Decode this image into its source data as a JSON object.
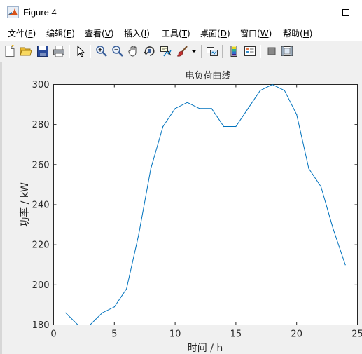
{
  "window": {
    "title": "Figure 4",
    "icons": [
      "matlab-logo-icon",
      "minimize-icon",
      "maximize-icon"
    ]
  },
  "menu": {
    "items": [
      {
        "name": "menu-file",
        "label": "文件(",
        "key": "F",
        "end": ")"
      },
      {
        "name": "menu-edit",
        "label": "编辑(",
        "key": "E",
        "end": ")"
      },
      {
        "name": "menu-view",
        "label": "查看(",
        "key": "V",
        "end": ")"
      },
      {
        "name": "menu-insert",
        "label": "插入(",
        "key": "I",
        "end": ")"
      },
      {
        "name": "menu-tools",
        "label": "工具(",
        "key": "T",
        "end": ")"
      },
      {
        "name": "menu-desktop",
        "label": "桌面(",
        "key": "D",
        "end": ")"
      },
      {
        "name": "menu-window",
        "label": "窗口(",
        "key": "W",
        "end": ")"
      },
      {
        "name": "menu-help",
        "label": "帮助(",
        "key": "H",
        "end": ")"
      }
    ]
  },
  "toolbar": {
    "icons": [
      "new-figure-icon",
      "open-file-icon",
      "save-icon",
      "print-icon",
      "edit-plot-icon",
      "zoom-in-icon",
      "zoom-out-icon",
      "pan-icon",
      "rotate-3d-icon",
      "data-cursor-icon",
      "brush-icon",
      "brush-dropdown-icon",
      "link-plot-icon",
      "insert-colorbar-icon",
      "insert-legend-icon",
      "hide-plot-tools-icon",
      "show-plot-tools-icon"
    ]
  },
  "colors": {
    "line": "#0072bd",
    "figure_bg": "#f0f0f0",
    "axes_bg": "#ffffff"
  },
  "chart_data": {
    "type": "line",
    "title": "电负荷曲线",
    "xlabel": "时间 / h",
    "ylabel": "功率 / kW",
    "xlim": [
      0,
      25
    ],
    "ylim": [
      180,
      300
    ],
    "xticks": [
      0,
      5,
      10,
      15,
      20,
      25
    ],
    "yticks": [
      180,
      200,
      220,
      240,
      260,
      280,
      300
    ],
    "grid": false,
    "series": [
      {
        "x": [
          1,
          2,
          3,
          4,
          5,
          6,
          7,
          8,
          9,
          10,
          11,
          12,
          13,
          14,
          15,
          16,
          17,
          18,
          19,
          20,
          21,
          22,
          23,
          24
        ],
        "values": [
          186,
          180,
          180,
          186,
          189,
          198,
          225,
          258,
          279,
          288,
          291,
          288,
          288,
          279,
          279,
          288,
          297,
          300,
          297,
          285,
          258,
          249,
          228,
          210
        ]
      }
    ]
  }
}
